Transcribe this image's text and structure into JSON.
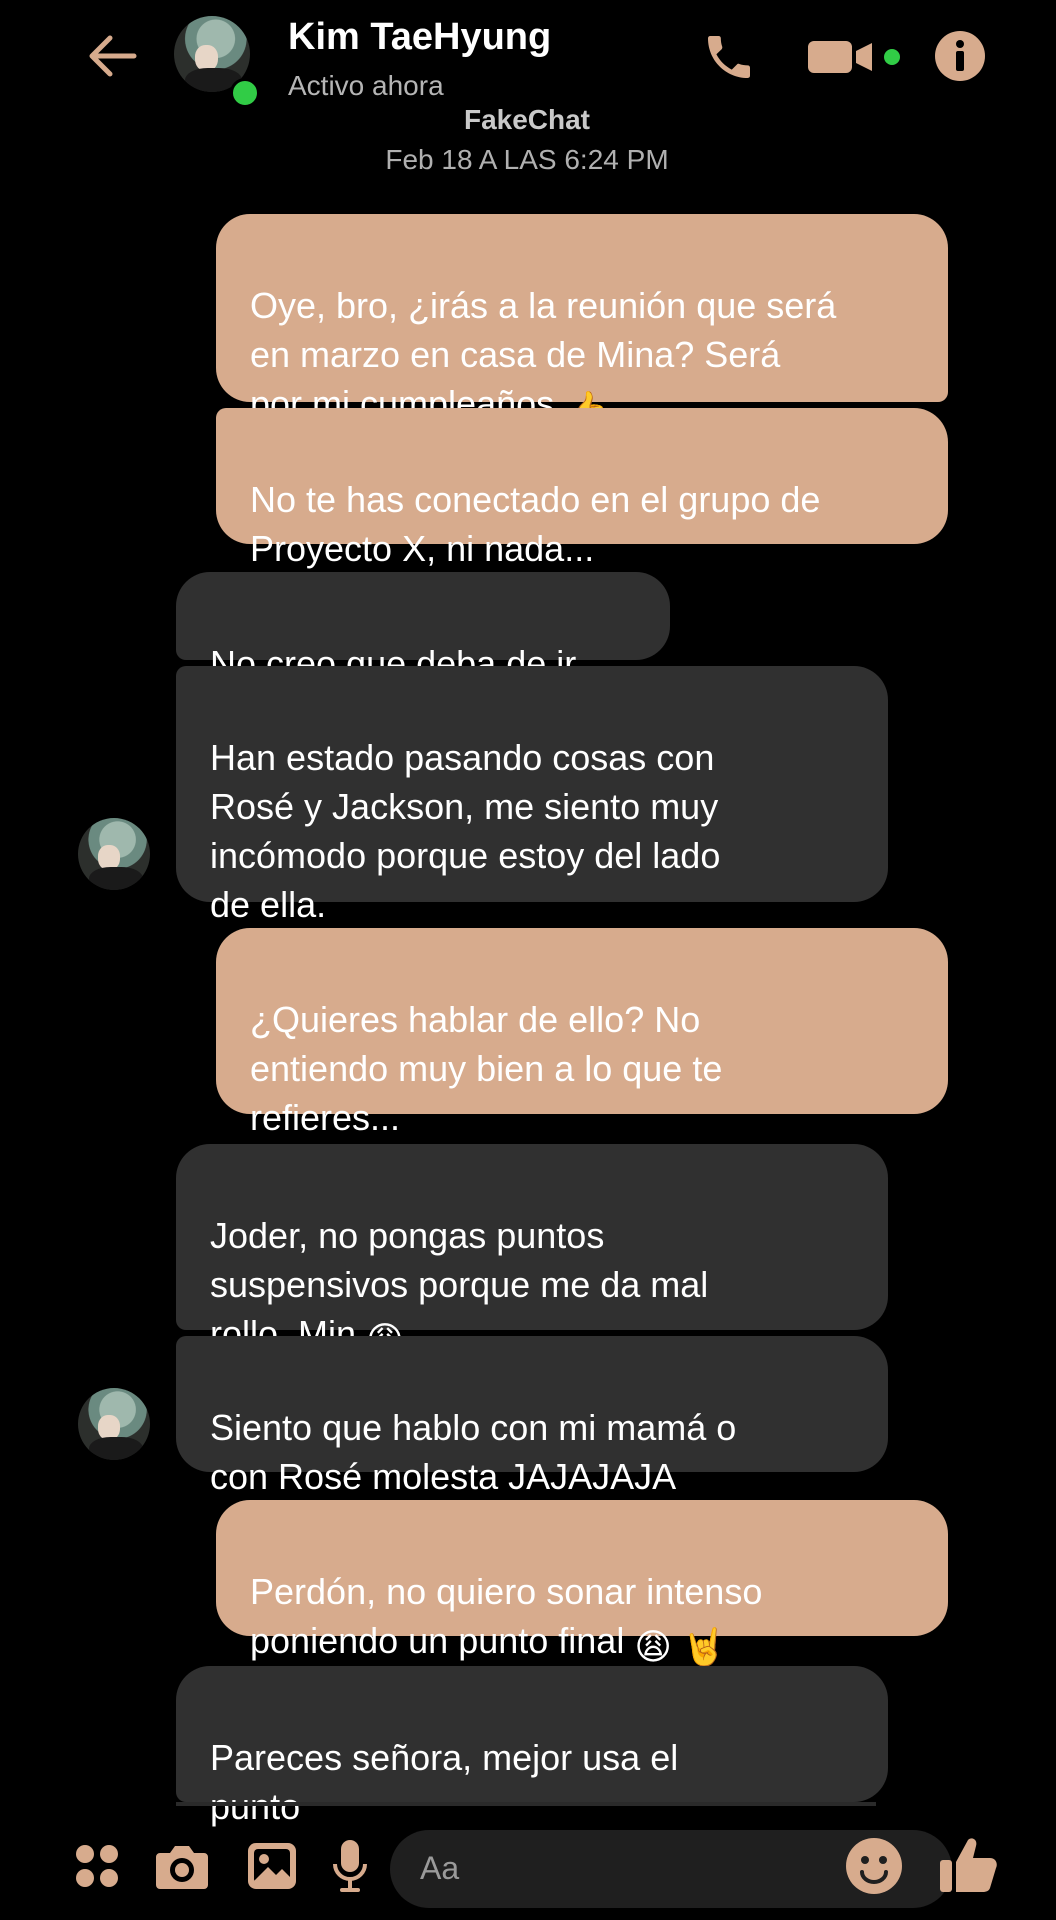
{
  "header": {
    "contact_name": "Kim TaeHyung",
    "status": "Activo ahora",
    "watermark": "FakeChat",
    "timestamp": "Feb 18 A LAS 6:24 PM"
  },
  "colors": {
    "outgoing_bubble": "#d7ab8d",
    "incoming_bubble": "#303030",
    "accent": "#d7ab8d",
    "online": "#31cc46",
    "background": "#000000"
  },
  "icons": {
    "back": "arrow-left-icon",
    "call": "phone-icon",
    "video": "video-camera-icon",
    "info": "info-icon",
    "apps": "grid-dots-icon",
    "camera": "camera-icon",
    "gallery": "image-icon",
    "mic": "microphone-icon",
    "emoji": "smile-icon",
    "like": "thumbs-up-icon"
  },
  "messages": [
    {
      "direction": "outgoing",
      "text": "Oye, bro, ¿irás a la reunión que será\nen marzo en casa de Mina? Será\npor mi cumpleaños",
      "emoji": "👍"
    },
    {
      "direction": "outgoing",
      "text": "No te has conectado en el grupo de\nProyecto X, ni nada..."
    },
    {
      "direction": "incoming",
      "text": "No creo que deba de ir."
    },
    {
      "direction": "incoming",
      "text": "Han estado pasando cosas con\nRosé y Jackson, me siento muy\nincómodo porque estoy del lado\nde ella."
    },
    {
      "direction": "outgoing",
      "text": "¿Quieres hablar de ello? No\nentiendo muy bien a lo que te\nrefieres..."
    },
    {
      "direction": "incoming",
      "text": "Joder, no pongas puntos\nsuspensivos porque me da mal\nrollo, Min",
      "emoji": "😩"
    },
    {
      "direction": "incoming",
      "text": "Siento que hablo con mi mamá o\ncon Rosé molesta JAJAJAJA"
    },
    {
      "direction": "outgoing",
      "text": "Perdón, no quiero sonar intenso\nponiendo un punto final",
      "emoji": "😩 🤘"
    },
    {
      "direction": "incoming",
      "text": "Pareces señora, mejor usa el\npunto"
    }
  ],
  "composer": {
    "placeholder": "Aa"
  }
}
